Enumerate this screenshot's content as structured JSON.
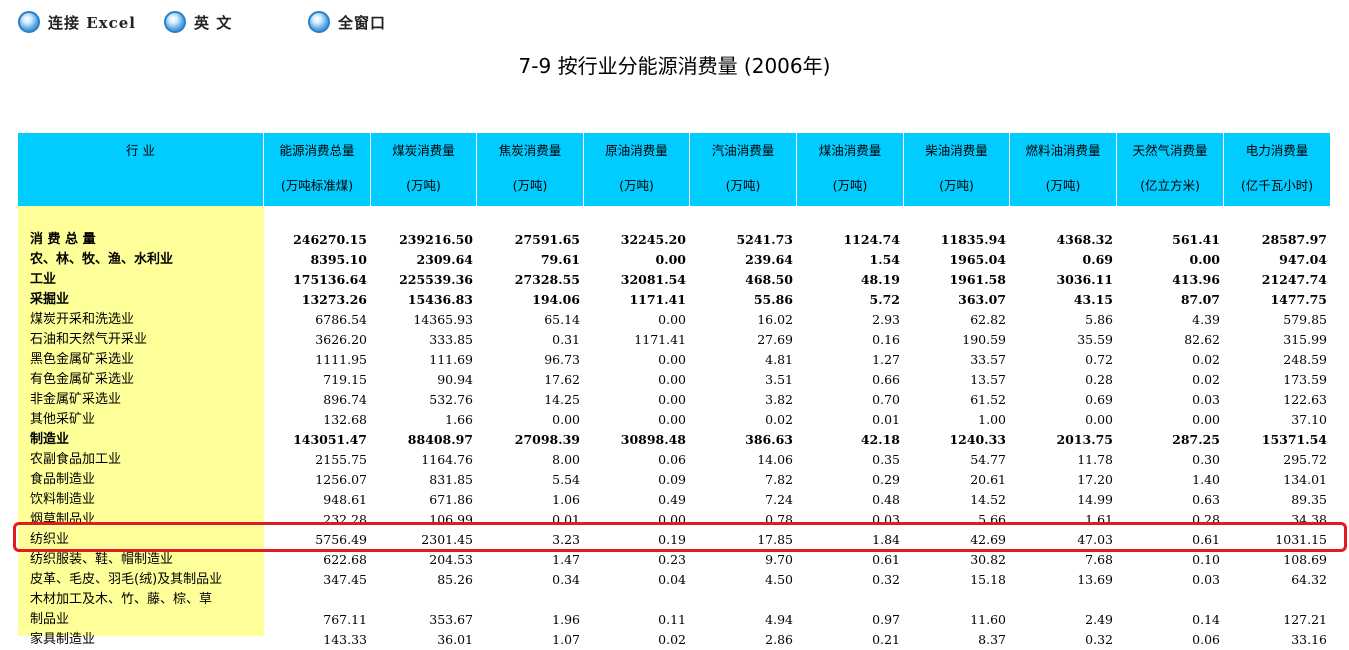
{
  "nav": {
    "excel": "连接 Excel",
    "english": "英  文",
    "fullwin": "全窗口"
  },
  "title": "7-9   按行业分能源消费量 (2006年)",
  "columns": [
    {
      "l1": "行          业",
      "l2": ""
    },
    {
      "l1": "能源消费总量",
      "l2": "(万吨标准煤)"
    },
    {
      "l1": "煤炭消费量",
      "l2": "(万吨)"
    },
    {
      "l1": "焦炭消费量",
      "l2": "(万吨)"
    },
    {
      "l1": "原油消费量",
      "l2": "(万吨)"
    },
    {
      "l1": "汽油消费量",
      "l2": "(万吨)"
    },
    {
      "l1": "煤油消费量",
      "l2": "(万吨)"
    },
    {
      "l1": "柴油消费量",
      "l2": "(万吨)"
    },
    {
      "l1": "燃料油消费量",
      "l2": "(万吨)"
    },
    {
      "l1": "天然气消费量",
      "l2": "(亿立方米)"
    },
    {
      "l1": "电力消费量",
      "l2": "(亿千瓦小时)"
    }
  ],
  "rows": [
    {
      "label": "  消 费 总 量",
      "bold": true,
      "values": [
        "246270.15",
        "239216.50",
        "27591.65",
        "32245.20",
        "5241.73",
        "1124.74",
        "11835.94",
        "4368.32",
        "561.41",
        "28587.97"
      ]
    },
    {
      "label": "农、林、牧、渔、水利业",
      "bold": true,
      "values": [
        "8395.10",
        "2309.64",
        "79.61",
        "0.00",
        "239.64",
        "1.54",
        "1965.04",
        "0.69",
        "0.00",
        "947.04"
      ]
    },
    {
      "label": "工业",
      "bold": true,
      "values": [
        "175136.64",
        "225539.36",
        "27328.55",
        "32081.54",
        "468.50",
        "48.19",
        "1961.58",
        "3036.11",
        "413.96",
        "21247.74"
      ]
    },
    {
      "label": "采掘业",
      "bold": true,
      "values": [
        "13273.26",
        "15436.83",
        "194.06",
        "1171.41",
        "55.86",
        "5.72",
        "363.07",
        "43.15",
        "87.07",
        "1477.75"
      ]
    },
    {
      "label": "煤炭开采和洗选业",
      "bold": false,
      "values": [
        "6786.54",
        "14365.93",
        "65.14",
        "0.00",
        "16.02",
        "2.93",
        "62.82",
        "5.86",
        "4.39",
        "579.85"
      ]
    },
    {
      "label": "石油和天然气开采业",
      "bold": false,
      "values": [
        "3626.20",
        "333.85",
        "0.31",
        "1171.41",
        "27.69",
        "0.16",
        "190.59",
        "35.59",
        "82.62",
        "315.99"
      ]
    },
    {
      "label": "黑色金属矿采选业",
      "bold": false,
      "values": [
        "1111.95",
        "111.69",
        "96.73",
        "0.00",
        "4.81",
        "1.27",
        "33.57",
        "0.72",
        "0.02",
        "248.59"
      ]
    },
    {
      "label": "有色金属矿采选业",
      "bold": false,
      "values": [
        "719.15",
        "90.94",
        "17.62",
        "0.00",
        "3.51",
        "0.66",
        "13.57",
        "0.28",
        "0.02",
        "173.59"
      ]
    },
    {
      "label": "非金属矿采选业",
      "bold": false,
      "values": [
        "896.74",
        "532.76",
        "14.25",
        "0.00",
        "3.82",
        "0.70",
        "61.52",
        "0.69",
        "0.03",
        "122.63"
      ]
    },
    {
      "label": "其他采矿业",
      "bold": false,
      "values": [
        "132.68",
        "1.66",
        "0.00",
        "0.00",
        "0.02",
        "0.01",
        "1.00",
        "0.00",
        "0.00",
        "37.10"
      ]
    },
    {
      "label": "制造业",
      "bold": true,
      "values": [
        "143051.47",
        "88408.97",
        "27098.39",
        "30898.48",
        "386.63",
        "42.18",
        "1240.33",
        "2013.75",
        "287.25",
        "15371.54"
      ]
    },
    {
      "label": "农副食品加工业",
      "bold": false,
      "values": [
        "2155.75",
        "1164.76",
        "8.00",
        "0.06",
        "14.06",
        "0.35",
        "54.77",
        "11.78",
        "0.30",
        "295.72"
      ]
    },
    {
      "label": "食品制造业",
      "bold": false,
      "values": [
        "1256.07",
        "831.85",
        "5.54",
        "0.09",
        "7.82",
        "0.29",
        "20.61",
        "17.20",
        "1.40",
        "134.01"
      ]
    },
    {
      "label": "饮料制造业",
      "bold": false,
      "values": [
        "948.61",
        "671.86",
        "1.06",
        "0.49",
        "7.24",
        "0.48",
        "14.52",
        "14.99",
        "0.63",
        "89.35"
      ]
    },
    {
      "label": "烟草制品业",
      "bold": false,
      "values": [
        "232.28",
        "106.99",
        "0.01",
        "0.00",
        "0.78",
        "0.03",
        "5.66",
        "1.61",
        "0.28",
        "34.38"
      ]
    },
    {
      "label": "纺织业",
      "bold": false,
      "values": [
        "5756.49",
        "2301.45",
        "3.23",
        "0.19",
        "17.85",
        "1.84",
        "42.69",
        "47.03",
        "0.61",
        "1031.15"
      ]
    },
    {
      "label": "纺织服装、鞋、帽制造业",
      "bold": false,
      "values": [
        "622.68",
        "204.53",
        "1.47",
        "0.23",
        "9.70",
        "0.61",
        "30.82",
        "7.68",
        "0.10",
        "108.69"
      ]
    },
    {
      "label": "皮革、毛皮、羽毛(绒)及其制品业",
      "bold": false,
      "values": [
        "347.45",
        "85.26",
        "0.34",
        "0.04",
        "4.50",
        "0.32",
        "15.18",
        "13.69",
        "0.03",
        "64.32"
      ]
    },
    {
      "label": "木材加工及木、竹、藤、棕、草",
      "bold": false,
      "values": [
        "",
        "",
        "",
        "",
        "",
        "",
        "",
        "",
        "",
        ""
      ]
    },
    {
      "label": "  制品业",
      "bold": false,
      "values": [
        "767.11",
        "353.67",
        "1.96",
        "0.11",
        "4.94",
        "0.97",
        "11.60",
        "2.49",
        "0.14",
        "127.21"
      ]
    },
    {
      "label": "家具制造业",
      "bold": false,
      "values": [
        "143.33",
        "36.01",
        "1.07",
        "0.02",
        "2.86",
        "0.21",
        "8.37",
        "0.32",
        "0.06",
        "33.16"
      ]
    }
  ]
}
